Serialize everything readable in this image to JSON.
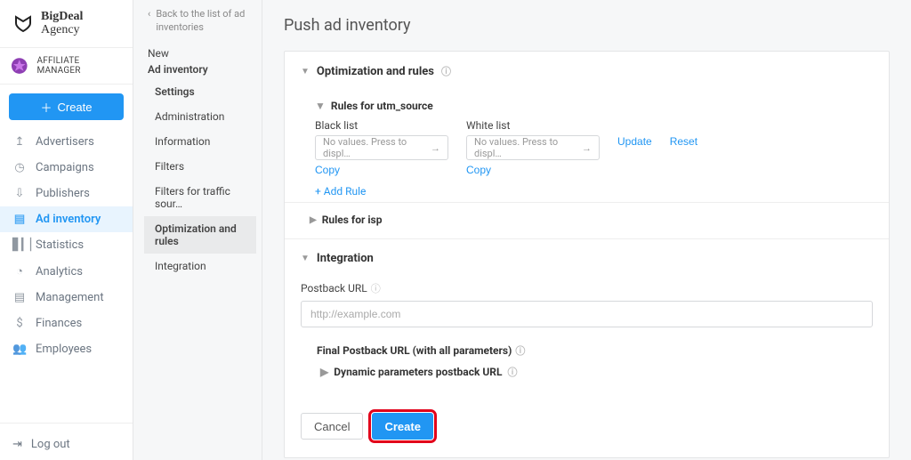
{
  "brand": {
    "line1": "BigDeal",
    "line2": "Agency"
  },
  "role": "AFFILIATE MANAGER",
  "create_button": "Create",
  "nav": {
    "items": [
      {
        "label": "Advertisers",
        "icon": "↥"
      },
      {
        "label": "Campaigns",
        "icon": "◷"
      },
      {
        "label": "Publishers",
        "icon": "⇩"
      },
      {
        "label": "Ad inventory",
        "icon": "▤",
        "active": true
      },
      {
        "label": "Statistics",
        "icon": "▋▎▏"
      },
      {
        "label": "Analytics",
        "icon": "◔"
      },
      {
        "label": "Management",
        "icon": "▤"
      },
      {
        "label": "Finances",
        "icon": "$"
      },
      {
        "label": "Employees",
        "icon": "👥"
      }
    ],
    "logout": "Log out"
  },
  "subnav": {
    "back": "Back to the list of ad inventories",
    "new_label": "New",
    "root": "Ad inventory",
    "items": [
      {
        "label": "Settings",
        "bold": true
      },
      {
        "label": "Administration"
      },
      {
        "label": "Information"
      },
      {
        "label": "Filters"
      },
      {
        "label": "Filters for traffic sour…"
      },
      {
        "label": "Optimization and rules",
        "selected": true
      },
      {
        "label": "Integration"
      }
    ]
  },
  "page_title": "Push ad inventory",
  "optimization": {
    "title": "Optimization and rules",
    "rules_for": "Rules for utm_source",
    "blacklist_label": "Black list",
    "whitelist_label": "White list",
    "dd_placeholder": "No values. Press to displ…",
    "update": "Update",
    "reset": "Reset",
    "copy": "Copy",
    "add_rule": "+ Add Rule",
    "rules_isp": "Rules for isp"
  },
  "integration": {
    "title": "Integration",
    "postback_label": "Postback URL",
    "postback_placeholder": "http://example.com",
    "final_label": "Final Postback URL (with all parameters)",
    "dynamic_label": "Dynamic parameters postback URL"
  },
  "footer": {
    "cancel": "Cancel",
    "create": "Create"
  }
}
